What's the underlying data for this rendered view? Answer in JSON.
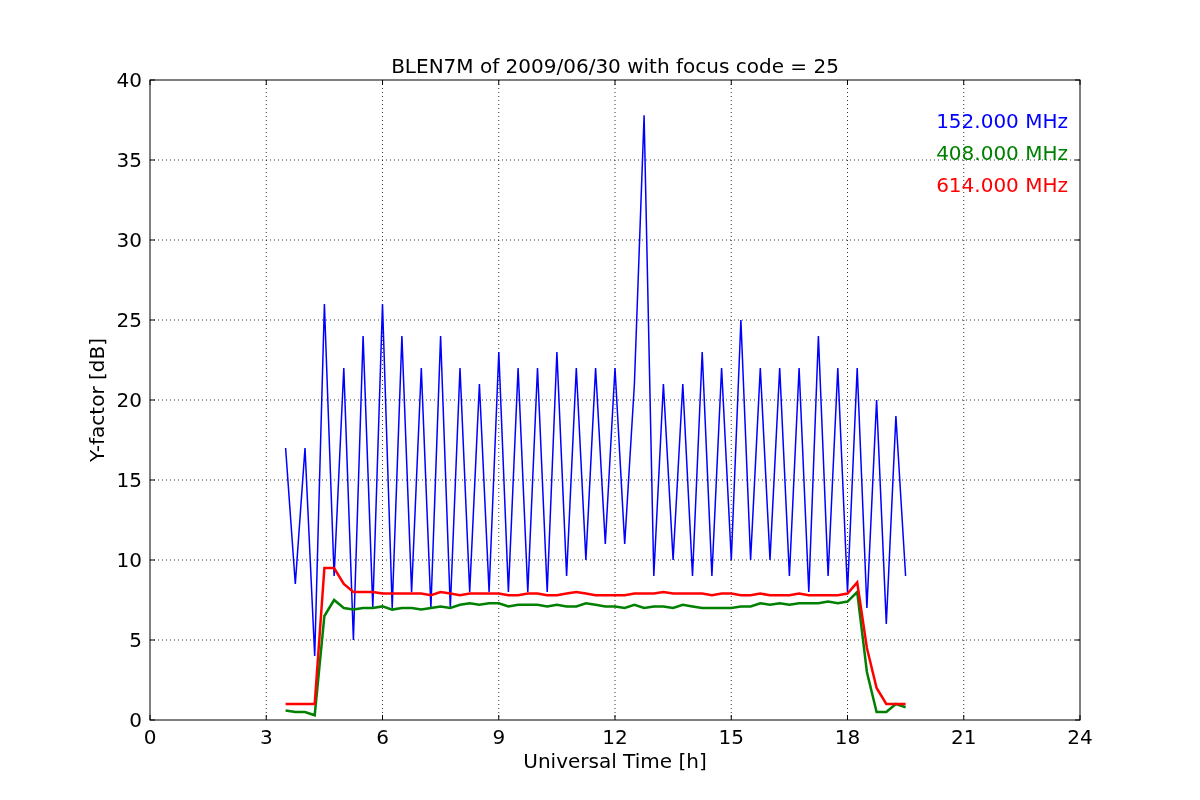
{
  "chart_data": {
    "type": "line",
    "title": "BLEN7M of 2009/06/30 with focus code = 25",
    "xlabel": "Universal Time [h]",
    "ylabel": "Y-factor [dB]",
    "x": [
      3.5,
      3.75,
      4.0,
      4.25,
      4.5,
      4.75,
      5.0,
      5.25,
      5.5,
      5.75,
      6.0,
      6.25,
      6.5,
      6.75,
      7.0,
      7.25,
      7.5,
      7.75,
      8.0,
      8.25,
      8.5,
      8.75,
      9.0,
      9.25,
      9.5,
      9.75,
      10.0,
      10.25,
      10.5,
      10.75,
      11.0,
      11.25,
      11.5,
      11.75,
      12.0,
      12.25,
      12.5,
      12.75,
      13.0,
      13.25,
      13.5,
      13.75,
      14.0,
      14.25,
      14.5,
      14.75,
      15.0,
      15.25,
      15.5,
      15.75,
      16.0,
      16.25,
      16.5,
      16.75,
      17.0,
      17.25,
      17.5,
      17.75,
      18.0,
      18.25,
      18.5,
      18.75,
      19.0,
      19.25,
      19.5
    ],
    "series": [
      {
        "name": "152.000 MHz",
        "color": "#0000ff",
        "values": [
          17,
          8.5,
          17,
          4,
          26,
          9,
          22,
          5,
          24,
          7,
          26,
          7,
          24,
          8,
          22,
          7,
          24,
          7,
          22,
          8,
          21,
          8,
          23,
          8,
          22,
          8,
          22,
          8,
          23,
          9,
          22,
          10,
          22,
          11,
          22,
          11,
          21,
          37.8,
          9,
          21,
          10,
          21,
          9,
          23,
          9,
          22,
          10,
          25,
          10,
          22,
          10,
          22,
          9,
          22,
          8,
          24,
          9,
          22,
          8,
          22,
          7,
          20,
          6,
          19,
          9
        ]
      },
      {
        "name": "408.000 MHz",
        "color": "#008000",
        "values": [
          0.6,
          0.5,
          0.5,
          0.3,
          6.5,
          7.5,
          7,
          6.9,
          7,
          7,
          7.1,
          6.9,
          7,
          7,
          6.9,
          7,
          7.1,
          7,
          7.2,
          7.3,
          7.2,
          7.3,
          7.3,
          7.1,
          7.2,
          7.2,
          7.2,
          7.1,
          7.2,
          7.1,
          7.1,
          7.3,
          7.2,
          7.1,
          7.1,
          7,
          7.2,
          7,
          7.1,
          7.1,
          7,
          7.2,
          7.1,
          7,
          7,
          7,
          7,
          7.1,
          7.1,
          7.3,
          7.2,
          7.3,
          7.2,
          7.3,
          7.3,
          7.3,
          7.4,
          7.3,
          7.4,
          8,
          3,
          0.5,
          0.5,
          1,
          0.8
        ]
      },
      {
        "name": "614.000 MHz",
        "color": "#ff0000",
        "values": [
          1,
          1,
          1,
          1,
          9.5,
          9.5,
          8.5,
          8,
          8,
          8,
          7.9,
          7.9,
          7.9,
          7.9,
          7.9,
          7.8,
          8,
          7.9,
          7.8,
          7.9,
          7.9,
          7.9,
          7.9,
          7.8,
          7.8,
          7.9,
          7.9,
          7.8,
          7.8,
          7.9,
          8,
          7.9,
          7.8,
          7.8,
          7.8,
          7.8,
          7.9,
          7.9,
          7.9,
          8,
          7.9,
          7.9,
          7.9,
          7.9,
          7.8,
          7.9,
          7.9,
          7.8,
          7.8,
          7.9,
          7.8,
          7.8,
          7.8,
          7.9,
          7.8,
          7.8,
          7.8,
          7.8,
          7.9,
          8.6,
          4.5,
          2,
          1,
          1,
          1
        ]
      }
    ],
    "grid": true,
    "xlim": [
      0,
      24
    ],
    "ylim": [
      0,
      40
    ],
    "xticks": [
      0,
      3,
      6,
      9,
      12,
      15,
      18,
      21,
      24
    ],
    "yticks": [
      0,
      5,
      10,
      15,
      20,
      25,
      30,
      35,
      40
    ]
  }
}
